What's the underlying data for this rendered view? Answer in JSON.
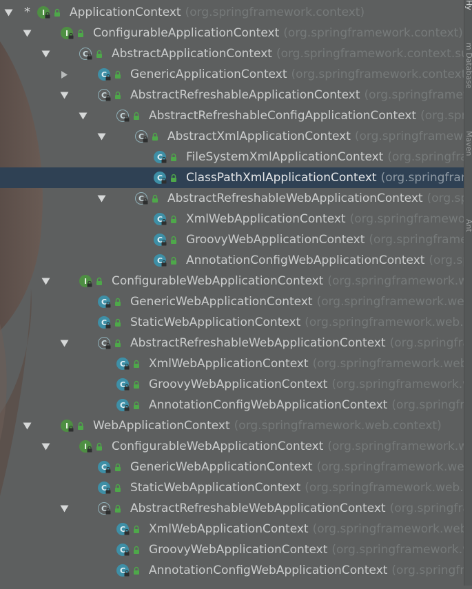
{
  "tree": {
    "rows": [
      {
        "depth": 0,
        "arrow": "down",
        "star": true,
        "icon": "interface",
        "name": "ApplicationContext",
        "pkg": "(org.springframework.context)"
      },
      {
        "depth": 1,
        "arrow": "down",
        "icon": "interface",
        "name": "ConfigurableApplicationContext",
        "pkg": "(org.springframework.context)"
      },
      {
        "depth": 2,
        "arrow": "down",
        "icon": "abstract",
        "name": "AbstractApplicationContext",
        "pkg": "(org.springframework.context.sup"
      },
      {
        "depth": 3,
        "arrow": "right",
        "icon": "class",
        "name": "GenericApplicationContext",
        "pkg": "(org.springframework.context.su"
      },
      {
        "depth": 3,
        "arrow": "down",
        "icon": "abstract",
        "name": "AbstractRefreshableApplicationContext",
        "pkg": "(org.springframew"
      },
      {
        "depth": 4,
        "arrow": "down",
        "icon": "abstract",
        "name": "AbstractRefreshableConfigApplicationContext",
        "pkg": "(org.sprin"
      },
      {
        "depth": 5,
        "arrow": "down",
        "icon": "abstract",
        "name": "AbstractXmlApplicationContext",
        "pkg": "(org.springframewor"
      },
      {
        "depth": 6,
        "arrow": "none",
        "icon": "class",
        "name": "FileSystemXmlApplicationContext",
        "pkg": "(org.springfram"
      },
      {
        "depth": 6,
        "arrow": "none",
        "icon": "class",
        "name": "ClassPathXmlApplicationContext",
        "pkg": "(org.springframe",
        "selected": true
      },
      {
        "depth": 5,
        "arrow": "down",
        "icon": "abstract",
        "name": "AbstractRefreshableWebApplicationContext",
        "pkg": "(org.spr"
      },
      {
        "depth": 6,
        "arrow": "none",
        "icon": "class",
        "name": "XmlWebApplicationContext",
        "pkg": "(org.springframewor"
      },
      {
        "depth": 6,
        "arrow": "none",
        "icon": "class",
        "name": "GroovyWebApplicationContext",
        "pkg": "(org.springframew"
      },
      {
        "depth": 6,
        "arrow": "none",
        "icon": "class",
        "name": "AnnotationConfigWebApplicationContext",
        "pkg": "(org.sp"
      },
      {
        "depth": 2,
        "arrow": "down",
        "icon": "interface",
        "name": "ConfigurableWebApplicationContext",
        "pkg": "(org.springframework.we"
      },
      {
        "depth": 3,
        "arrow": "none",
        "icon": "class",
        "name": "GenericWebApplicationContext",
        "pkg": "(org.springframework.web"
      },
      {
        "depth": 3,
        "arrow": "none",
        "icon": "class",
        "name": "StaticWebApplicationContext",
        "pkg": "(org.springframework.web.c"
      },
      {
        "depth": 3,
        "arrow": "down",
        "icon": "abstract",
        "name": "AbstractRefreshableWebApplicationContext",
        "pkg": "(org.springfra"
      },
      {
        "depth": 4,
        "arrow": "none",
        "icon": "class",
        "name": "XmlWebApplicationContext",
        "pkg": "(org.springframework.web."
      },
      {
        "depth": 4,
        "arrow": "none",
        "icon": "class",
        "name": "GroovyWebApplicationContext",
        "pkg": "(org.springframework.w"
      },
      {
        "depth": 4,
        "arrow": "none",
        "icon": "class",
        "name": "AnnotationConfigWebApplicationContext",
        "pkg": "(org.springfra"
      },
      {
        "depth": 1,
        "arrow": "down",
        "icon": "interface",
        "name": "WebApplicationContext",
        "pkg": "(org.springframework.web.context)"
      },
      {
        "depth": 2,
        "arrow": "down",
        "icon": "interface",
        "name": "ConfigurableWebApplicationContext",
        "pkg": "(org.springframework.we"
      },
      {
        "depth": 3,
        "arrow": "none",
        "icon": "class",
        "name": "GenericWebApplicationContext",
        "pkg": "(org.springframework.web"
      },
      {
        "depth": 3,
        "arrow": "none",
        "icon": "class",
        "name": "StaticWebApplicationContext",
        "pkg": "(org.springframework.web.c"
      },
      {
        "depth": 3,
        "arrow": "down",
        "icon": "abstract",
        "name": "AbstractRefreshableWebApplicationContext",
        "pkg": "(org.springfra"
      },
      {
        "depth": 4,
        "arrow": "none",
        "icon": "class",
        "name": "XmlWebApplicationContext",
        "pkg": "(org.springframework.web."
      },
      {
        "depth": 4,
        "arrow": "none",
        "icon": "class",
        "name": "GroovyWebApplicationContext",
        "pkg": "(org.springframework.w"
      },
      {
        "depth": 4,
        "arrow": "none",
        "icon": "class",
        "name": "AnnotationConfigWebApplicationContext",
        "pkg": "(org.springfra"
      }
    ]
  },
  "sidebar": {
    "tabs": [
      "Hy",
      "m Database",
      "Maven",
      "Ant"
    ]
  },
  "icons": {
    "interface": "I",
    "class": "C",
    "abstract": "C"
  },
  "colors": {
    "background": "#5d5f5f",
    "selected_row": "#2f4154",
    "interface_icon": "#4e8f43",
    "class_icon": "#3e8fa6",
    "package_text": "#767a7a"
  }
}
